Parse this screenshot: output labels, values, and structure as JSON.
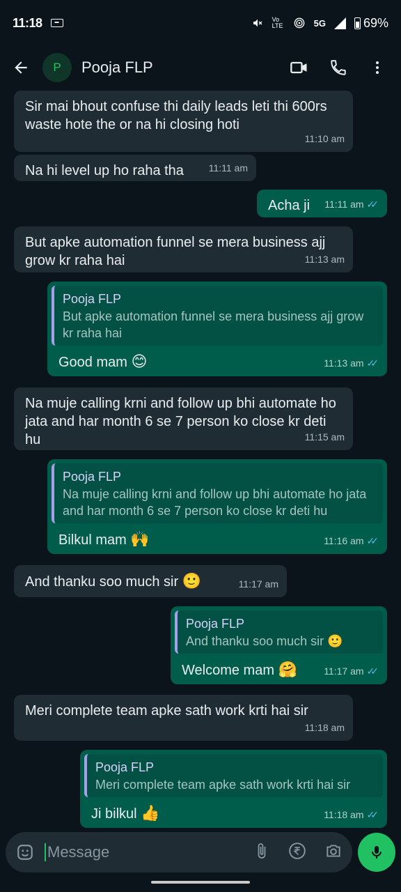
{
  "status_bar": {
    "time": "11:18",
    "network": "5G",
    "lte": "Vo LTE",
    "battery": "69%"
  },
  "header": {
    "avatar_letter": "P",
    "contact_name": "Pooja FLP"
  },
  "messages": [
    {
      "dir": "in",
      "text": "Sir mai bhout confuse thi daily leads leti thi 600rs waste hote the or na hi closing hoti",
      "time": "11:10 am"
    },
    {
      "dir": "in",
      "text": "Na hi level up ho raha tha",
      "time": "11:11 am"
    },
    {
      "dir": "out",
      "text": "Acha ji",
      "time": "11:11 am"
    },
    {
      "dir": "in",
      "text": "But apke automation funnel se mera business ajj grow kr raha hai",
      "time": "11:13 am"
    },
    {
      "dir": "out",
      "quote_name": "Pooja FLP",
      "quote_text": "But apke automation funnel se mera business ajj grow kr raha hai",
      "text": "Good mam",
      "emoji": "😊",
      "time": "11:13 am"
    },
    {
      "dir": "in",
      "text": "Na muje calling krni and  follow up  bhi automate ho jata and har month 6 se 7 person ko close kr deti hu",
      "time": "11:15 am"
    },
    {
      "dir": "out",
      "quote_name": "Pooja FLP",
      "quote_text": "Na muje calling krni and  follow up  bhi automate ho jata and har month 6 se 7 person ko close kr deti hu",
      "text": "Bilkul mam",
      "emoji": "🙌",
      "time": "11:16 am"
    },
    {
      "dir": "in",
      "text": "And thanku soo much sir",
      "emoji": "🙂",
      "time": "11:17 am"
    },
    {
      "dir": "out",
      "quote_name": "Pooja FLP",
      "quote_text": "And thanku soo much sir",
      "quote_emoji": "🙂",
      "text": "Welcome mam",
      "emoji": "🤗",
      "time": "11:17 am"
    },
    {
      "dir": "in",
      "text": "Meri complete team apke sath work krti hai sir",
      "time": "11:18 am"
    },
    {
      "dir": "out",
      "quote_name": "Pooja FLP",
      "quote_text": "Meri complete team apke sath work krti hai  sir",
      "text": "Ji bilkul",
      "emoji": "👍",
      "time": "11:18 am"
    }
  ],
  "read_receipt": "✓✓",
  "input": {
    "placeholder": "Message"
  },
  "colors": {
    "background": "#0b141a",
    "incoming_bubble": "#202c33",
    "outgoing_bubble": "#005c4b",
    "accent": "#21c063",
    "read_tick": "#53bdeb"
  },
  "icons": [
    "back-arrow-icon",
    "video-call-icon",
    "phone-icon",
    "more-vert-icon",
    "emoji-sticker-icon",
    "attach-icon",
    "rupee-icon",
    "camera-icon",
    "mic-icon"
  ]
}
